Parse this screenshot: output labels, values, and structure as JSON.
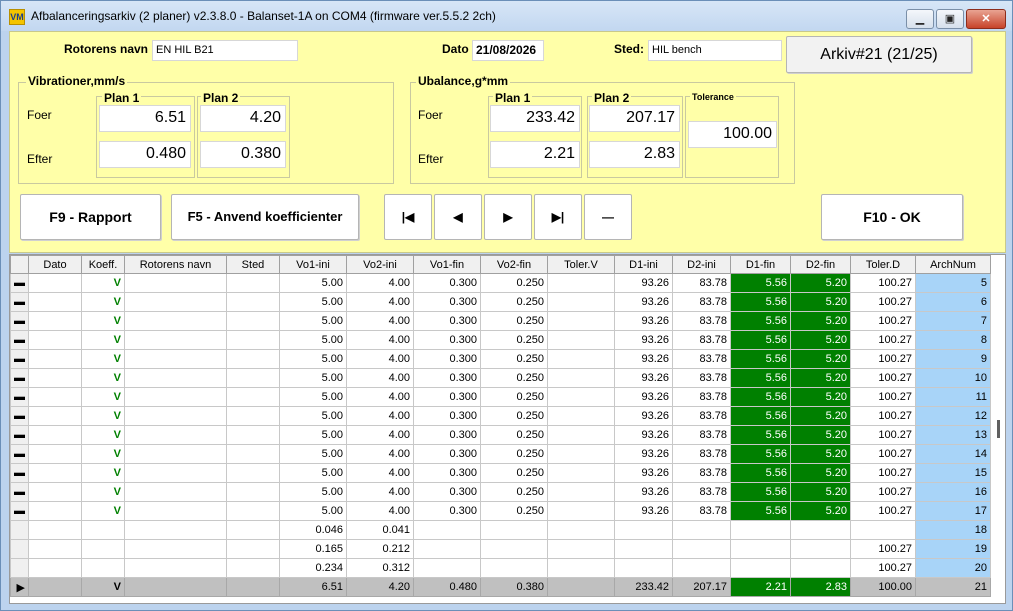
{
  "window": {
    "title": "Afbalanceringsarkiv (2 planer) v2.3.8.0 - Balanset-1A on COM4 (firmware ver.5.5.2 2ch)",
    "icon": "VM"
  },
  "header": {
    "rotor_label": "Rotorens navn",
    "rotor_value": "EN HIL B21",
    "date_label": "Dato",
    "date_value": "21/08/2026",
    "place_label": "Sted:",
    "place_value": "HIL bench",
    "archive_button": "Arkiv#21 (21/25)"
  },
  "vibration": {
    "title": "Vibrationer,mm/s",
    "plan1": "Plan 1",
    "plan2": "Plan 2",
    "before": "Foer",
    "after": "Efter",
    "p1_before": "6.51",
    "p2_before": "4.20",
    "p1_after": "0.480",
    "p2_after": "0.380"
  },
  "unbalance": {
    "title": "Ubalance,g*mm",
    "plan1": "Plan 1",
    "plan2": "Plan 2",
    "tolerance": "Tolerance",
    "before": "Foer",
    "after": "Efter",
    "p1_before": "233.42",
    "p2_before": "207.17",
    "p1_after": "2.21",
    "p2_after": "2.83",
    "tol_value": "100.00"
  },
  "buttons": {
    "report": "F9 - Rapport",
    "apply": "F5 - Anvend koefficienter",
    "first": "|◀",
    "prev": "◀",
    "next": "▶",
    "last": "▶|",
    "delete": "—",
    "ok": "F10 - OK"
  },
  "grid": {
    "columns": [
      "Dato",
      "Koeff.",
      "Rotorens navn",
      "Sted",
      "Vo1-ini",
      "Vo2-ini",
      "Vo1-fin",
      "Vo2-fin",
      "Toler.V",
      "D1-ini",
      "D2-ini",
      "D1-fin",
      "D2-fin",
      "Toler.D",
      "ArchNum"
    ],
    "rows": [
      {
        "ind": "▬",
        "k": "V",
        "v1i": "5.00",
        "v2i": "4.00",
        "v1f": "0.300",
        "v2f": "0.250",
        "tv": "",
        "d1i": "93.26",
        "d2i": "83.78",
        "d1f": "5.56",
        "d2f": "5.20",
        "td": "100.27",
        "n": "5"
      },
      {
        "ind": "▬",
        "k": "V",
        "v1i": "5.00",
        "v2i": "4.00",
        "v1f": "0.300",
        "v2f": "0.250",
        "tv": "",
        "d1i": "93.26",
        "d2i": "83.78",
        "d1f": "5.56",
        "d2f": "5.20",
        "td": "100.27",
        "n": "6"
      },
      {
        "ind": "▬",
        "k": "V",
        "v1i": "5.00",
        "v2i": "4.00",
        "v1f": "0.300",
        "v2f": "0.250",
        "tv": "",
        "d1i": "93.26",
        "d2i": "83.78",
        "d1f": "5.56",
        "d2f": "5.20",
        "td": "100.27",
        "n": "7"
      },
      {
        "ind": "▬",
        "k": "V",
        "v1i": "5.00",
        "v2i": "4.00",
        "v1f": "0.300",
        "v2f": "0.250",
        "tv": "",
        "d1i": "93.26",
        "d2i": "83.78",
        "d1f": "5.56",
        "d2f": "5.20",
        "td": "100.27",
        "n": "8"
      },
      {
        "ind": "▬",
        "k": "V",
        "v1i": "5.00",
        "v2i": "4.00",
        "v1f": "0.300",
        "v2f": "0.250",
        "tv": "",
        "d1i": "93.26",
        "d2i": "83.78",
        "d1f": "5.56",
        "d2f": "5.20",
        "td": "100.27",
        "n": "9"
      },
      {
        "ind": "▬",
        "k": "V",
        "v1i": "5.00",
        "v2i": "4.00",
        "v1f": "0.300",
        "v2f": "0.250",
        "tv": "",
        "d1i": "93.26",
        "d2i": "83.78",
        "d1f": "5.56",
        "d2f": "5.20",
        "td": "100.27",
        "n": "10"
      },
      {
        "ind": "▬",
        "k": "V",
        "v1i": "5.00",
        "v2i": "4.00",
        "v1f": "0.300",
        "v2f": "0.250",
        "tv": "",
        "d1i": "93.26",
        "d2i": "83.78",
        "d1f": "5.56",
        "d2f": "5.20",
        "td": "100.27",
        "n": "11"
      },
      {
        "ind": "▬",
        "k": "V",
        "v1i": "5.00",
        "v2i": "4.00",
        "v1f": "0.300",
        "v2f": "0.250",
        "tv": "",
        "d1i": "93.26",
        "d2i": "83.78",
        "d1f": "5.56",
        "d2f": "5.20",
        "td": "100.27",
        "n": "12"
      },
      {
        "ind": "▬",
        "k": "V",
        "v1i": "5.00",
        "v2i": "4.00",
        "v1f": "0.300",
        "v2f": "0.250",
        "tv": "",
        "d1i": "93.26",
        "d2i": "83.78",
        "d1f": "5.56",
        "d2f": "5.20",
        "td": "100.27",
        "n": "13"
      },
      {
        "ind": "▬",
        "k": "V",
        "v1i": "5.00",
        "v2i": "4.00",
        "v1f": "0.300",
        "v2f": "0.250",
        "tv": "",
        "d1i": "93.26",
        "d2i": "83.78",
        "d1f": "5.56",
        "d2f": "5.20",
        "td": "100.27",
        "n": "14"
      },
      {
        "ind": "▬",
        "k": "V",
        "v1i": "5.00",
        "v2i": "4.00",
        "v1f": "0.300",
        "v2f": "0.250",
        "tv": "",
        "d1i": "93.26",
        "d2i": "83.78",
        "d1f": "5.56",
        "d2f": "5.20",
        "td": "100.27",
        "n": "15"
      },
      {
        "ind": "▬",
        "k": "V",
        "v1i": "5.00",
        "v2i": "4.00",
        "v1f": "0.300",
        "v2f": "0.250",
        "tv": "",
        "d1i": "93.26",
        "d2i": "83.78",
        "d1f": "5.56",
        "d2f": "5.20",
        "td": "100.27",
        "n": "16"
      },
      {
        "ind": "▬",
        "k": "V",
        "v1i": "5.00",
        "v2i": "4.00",
        "v1f": "0.300",
        "v2f": "0.250",
        "tv": "",
        "d1i": "93.26",
        "d2i": "83.78",
        "d1f": "5.56",
        "d2f": "5.20",
        "td": "100.27",
        "n": "17"
      },
      {
        "ind": "",
        "k": "",
        "v1i": "0.046",
        "v2i": "0.041",
        "v1f": "",
        "v2f": "",
        "tv": "",
        "d1i": "",
        "d2i": "",
        "d1f": "",
        "d2f": "",
        "td": "",
        "n": "18"
      },
      {
        "ind": "",
        "k": "",
        "v1i": "0.165",
        "v2i": "0.212",
        "v1f": "",
        "v2f": "",
        "tv": "",
        "d1i": "",
        "d2i": "",
        "d1f": "",
        "d2f": "",
        "td": "100.27",
        "n": "19"
      },
      {
        "ind": "",
        "k": "",
        "v1i": "0.234",
        "v2i": "0.312",
        "v1f": "",
        "v2f": "",
        "tv": "",
        "d1i": "",
        "d2i": "",
        "d1f": "",
        "d2f": "",
        "td": "100.27",
        "n": "20"
      },
      {
        "ind": "▶",
        "k": "V",
        "v1i": "6.51",
        "v2i": "4.20",
        "v1f": "0.480",
        "v2f": "0.380",
        "tv": "",
        "d1i": "233.42",
        "d2i": "207.17",
        "d1f": "2.21",
        "d2f": "2.83",
        "td": "100.00",
        "n": "21"
      }
    ]
  }
}
